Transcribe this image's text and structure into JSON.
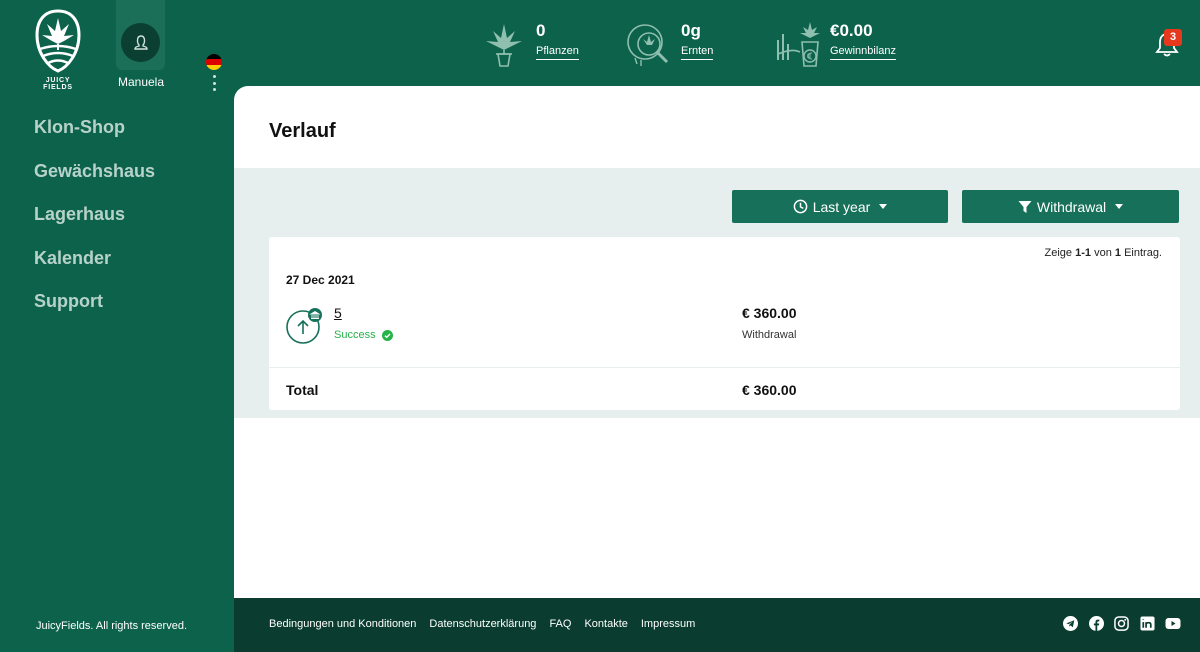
{
  "brand": {
    "logo_text": "JUICY FIELDS",
    "copyright": "JuicyFields. All rights reserved."
  },
  "user": {
    "name": "Manuela",
    "language_flag": "flag-de-icon"
  },
  "nav": {
    "items": [
      {
        "label": "Klon-Shop"
      },
      {
        "label": "Gewächshaus"
      },
      {
        "label": "Lagerhaus"
      },
      {
        "label": "Kalender"
      },
      {
        "label": "Support"
      }
    ]
  },
  "stats": [
    {
      "value": "0",
      "label": "Pflanzen",
      "icon": "plant-pot-icon"
    },
    {
      "value": "0g",
      "label": "Ernten",
      "icon": "harvest-magnifier-icon"
    },
    {
      "value": "€0.00",
      "label": "Gewinnbilanz",
      "icon": "profit-balance-icon"
    }
  ],
  "notifications": {
    "count": "3",
    "icon": "bell-icon"
  },
  "page": {
    "title": "Verlauf"
  },
  "filters": {
    "period": {
      "label": "Last year",
      "icon": "clock-icon"
    },
    "type": {
      "label": "Withdrawal",
      "icon": "filter-icon"
    }
  },
  "results": {
    "prefix": "Zeige",
    "range": "1-1",
    "mid": "von",
    "total": "1",
    "suffix": "Eintrag."
  },
  "transactions": [
    {
      "date": "27 Dec 2021",
      "id": "5",
      "status": "Success",
      "amount": "€ 360.00",
      "type": "Withdrawal"
    }
  ],
  "summary": {
    "label": "Total",
    "value": "€ 360.00"
  },
  "footer": {
    "links": [
      {
        "label": "Bedingungen und Konditionen"
      },
      {
        "label": "Datenschutzerklärung"
      },
      {
        "label": "FAQ"
      },
      {
        "label": "Kontakte"
      },
      {
        "label": "Impressum"
      }
    ],
    "social": [
      "telegram-icon",
      "facebook-icon",
      "instagram-icon",
      "linkedin-icon",
      "youtube-icon"
    ]
  },
  "colors": {
    "brand_green": "#0d624b",
    "button_green": "#17715a",
    "footer_dark": "#0a3d2f",
    "success": "#27b24a",
    "badge_red": "#e5381d"
  }
}
